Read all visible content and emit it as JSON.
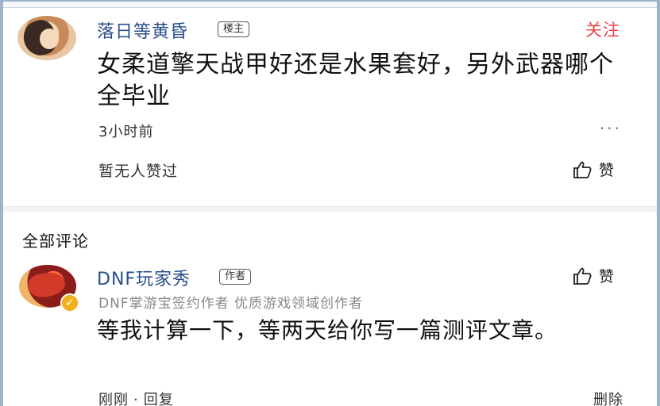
{
  "post": {
    "author": "落日等黄昏",
    "author_badge": "楼主",
    "follow_label": "关注",
    "text": "女柔道擎天战甲好还是水果套好，另外武器哪个全毕业",
    "time": "3小时前",
    "more_label": "···",
    "likes_text": "暂无人赞过",
    "like_label": "赞"
  },
  "comments": {
    "section_title": "全部评论",
    "items": [
      {
        "author": "DNF玩家秀",
        "author_badge": "作者",
        "sub_info": "DNF掌游宝签约作者 优质游戏领域创作者",
        "text": "等我计算一下，等两天给你写一篇测评文章。",
        "time": "刚刚",
        "separator": "·",
        "reply_label": "回复",
        "like_label": "赞",
        "delete_label": "删除"
      }
    ]
  },
  "colors": {
    "username": "#2b4f8a",
    "follow": "#e5484d",
    "muted": "#888888",
    "verified_badge": "#f2b01e"
  }
}
